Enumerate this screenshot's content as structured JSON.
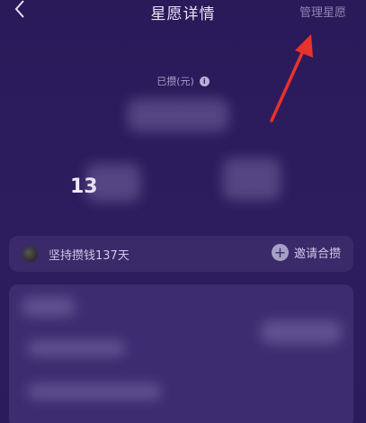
{
  "header": {
    "back_icon": "chevron-left-icon",
    "title": "星愿详情",
    "manage_label": "管理星愿"
  },
  "annotation": {
    "color": "#e8322c"
  },
  "saved": {
    "label": "已攒(元)",
    "info_icon": "i"
  },
  "stats": {
    "prefix": "13"
  },
  "streak": {
    "text": "坚持攒钱137天",
    "invite_label": "邀请合攒",
    "plus_icon": "+"
  },
  "colors": {
    "background": "#2c1c5c",
    "card": "#3a2a6a",
    "title_text": "#e8e2f4",
    "muted_text": "#8f84b0"
  }
}
